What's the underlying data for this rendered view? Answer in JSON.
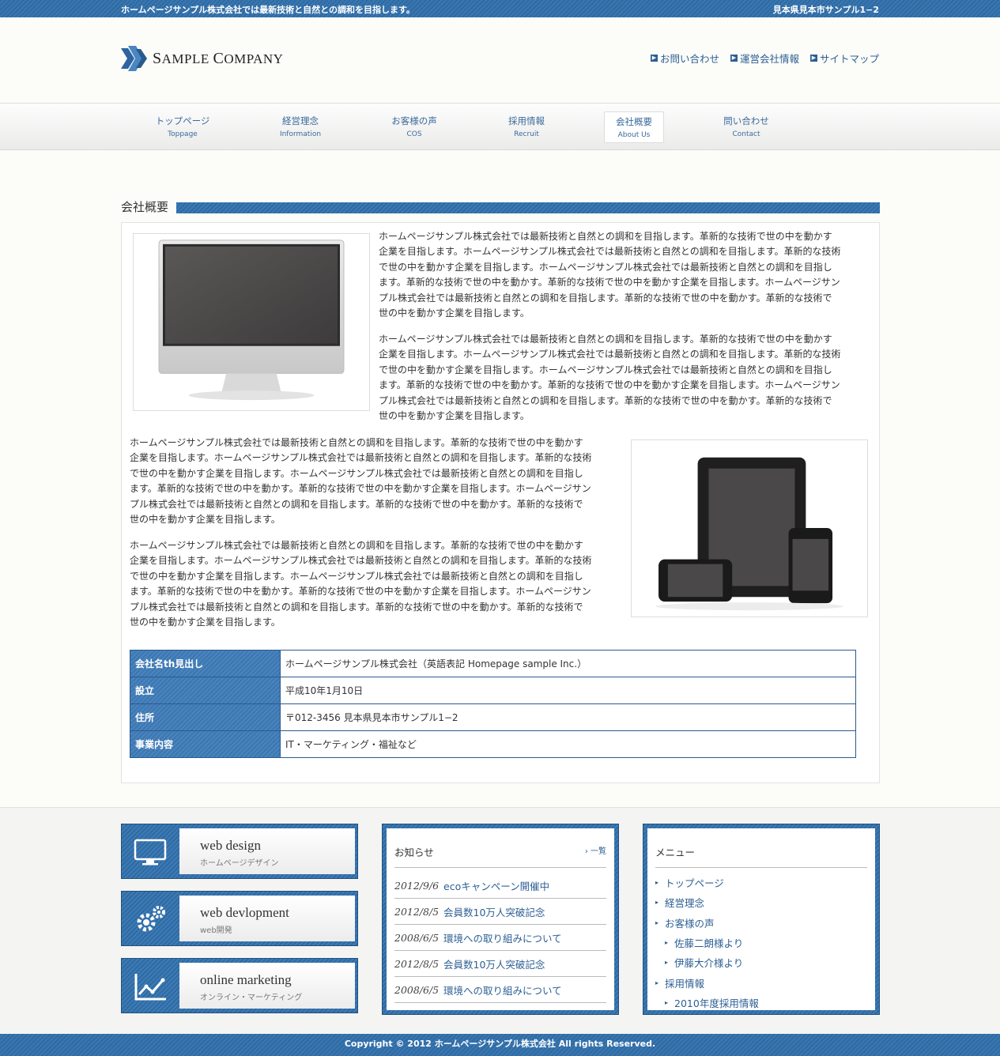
{
  "topbar": {
    "tagline": "ホームページサンプル株式会社では最新技術と自然との調和を目指します。",
    "address": "見本県見本市サンプル1−2"
  },
  "logo": {
    "first_initial": "S",
    "first_rest": "AMPLE",
    "second_initial": "C",
    "second_rest": "OMPANY"
  },
  "header_links": [
    {
      "label": "お問い合わせ"
    },
    {
      "label": "運営会社情報"
    },
    {
      "label": "サイトマップ"
    }
  ],
  "nav": [
    {
      "jp": "トップページ",
      "en": "Toppage"
    },
    {
      "jp": "経営理念",
      "en": "Information"
    },
    {
      "jp": "お客様の声",
      "en": "COS"
    },
    {
      "jp": "採用情報",
      "en": "Recruit"
    },
    {
      "jp": "会社概要",
      "en": "About Us"
    },
    {
      "jp": "問い合わせ",
      "en": "Contact"
    }
  ],
  "section": {
    "title": "会社概要"
  },
  "paragraph_lines": {
    "right1": [
      "ホームページサンプル株式会社では最新技術と自然との調和を目指します。革新的な技術で世の中を動かす",
      "企業を目指します。ホームページサンプル株式会社では最新技術と自然との調和を目指します。革新的な技術",
      "で世の中を動かす企業を目指します。ホームページサンプル株式会社では最新技術と自然との調和を目指し",
      "ます。革新的な技術で世の中を動かす。革新的な技術で世の中を動かす企業を目指します。ホームページサン",
      "プル株式会社では最新技術と自然との調和を目指します。革新的な技術で世の中を動かす。革新的な技術で",
      "世の中を動かす企業を目指します。"
    ],
    "left1": [
      "ホームページサンプル株式会社では最新技術と自然との調和を目指します。革新的な技術で世の中を動かす",
      "企業を目指します。ホームページサンプル株式会社では最新技術と自然との調和を目指します。革新的な技術",
      "で世の中を動かす企業を目指します。ホームページサンプル株式会社では最新技術と自然との調和を目指し",
      "ます。革新的な技術で世の中を動かす。革新的な技術で世の中を動かす企業を目指します。ホームページサン",
      "プル株式会社では最新技術と自然との調和を目指します。革新的な技術で世の中を動かす。革新的な技術で",
      "世の中を動かす企業を目指します。"
    ]
  },
  "company_table": [
    {
      "th": "会社名th見出し",
      "td": "ホームページサンプル株式会社（英語表記 Homepage sample Inc.）"
    },
    {
      "th": "設立",
      "td": "平成10年1月10日"
    },
    {
      "th": "住所",
      "td": "〒012-3456 見本県見本市サンプル1−2"
    },
    {
      "th": "事業内容",
      "td": "IT・マーケティング・福祉など"
    }
  ],
  "banners": [
    {
      "title": "web design",
      "sub": "ホームページデザイン",
      "icon": "monitor-icon"
    },
    {
      "title": "web devlopment",
      "sub": "web開発",
      "icon": "gears-icon"
    },
    {
      "title": "online marketing",
      "sub": "オンライン・マーケティング",
      "icon": "chart-icon"
    }
  ],
  "news": {
    "title": "お知らせ",
    "more": "一覧",
    "items": [
      {
        "date": "2012/9/6",
        "text": "ecoキャンペーン開催中"
      },
      {
        "date": "2012/8/5",
        "text": "会員数10万人突破記念"
      },
      {
        "date": "2008/6/5",
        "text": "環境への取り組みについて"
      },
      {
        "date": "2012/8/5",
        "text": "会員数10万人突破記念"
      },
      {
        "date": "2008/6/5",
        "text": "環境への取り組みについて"
      }
    ]
  },
  "menu": {
    "title": "メニュー",
    "items": [
      {
        "label": "トップページ",
        "sub": false
      },
      {
        "label": "経営理念",
        "sub": false
      },
      {
        "label": "お客様の声",
        "sub": false
      },
      {
        "label": "佐藤二朗様より",
        "sub": true
      },
      {
        "label": "伊藤大介様より",
        "sub": true
      },
      {
        "label": "採用情報",
        "sub": false
      },
      {
        "label": "2010年度採用情報",
        "sub": true
      }
    ]
  },
  "footer": {
    "copyright": "Copyright © 2012 ホームページサンプル株式会社 All rights Reserved."
  },
  "colors": {
    "accent": "#2f6aa3",
    "link": "#2d5f93",
    "background": "#fcfcf8"
  }
}
